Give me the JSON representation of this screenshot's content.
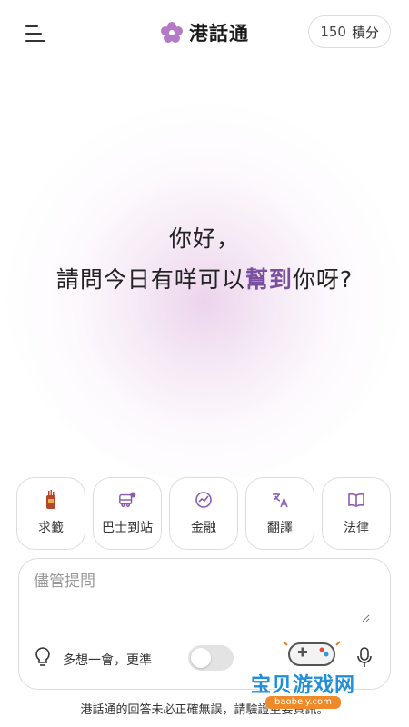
{
  "header": {
    "app_name": "港話通",
    "points_value": "150",
    "points_unit": "積分"
  },
  "greeting": {
    "line1": "你好，",
    "line2_before": "請問今日有咩可以",
    "line2_highlight": "幫到",
    "line2_after": "你呀?"
  },
  "cards": [
    {
      "label": "求籤",
      "icon": "fortune-sticks-icon"
    },
    {
      "label": "巴士到站",
      "icon": "bus-icon"
    },
    {
      "label": "金融",
      "icon": "finance-chart-icon"
    },
    {
      "label": "翻譯",
      "icon": "translate-icon"
    },
    {
      "label": "法律",
      "icon": "book-icon"
    }
  ],
  "input": {
    "placeholder": "儘管提問",
    "value": ""
  },
  "think_mode": {
    "label": "多想一會，更準",
    "enabled": false
  },
  "disclaimer": "港話通的回答未必正確無誤，請驗證重要資訊。",
  "watermark": {
    "text": "宝贝游戏网",
    "url": "baobeiy.com"
  },
  "colors": {
    "accent": "#7b4fa0",
    "logo_purple": "#b47ac6"
  }
}
